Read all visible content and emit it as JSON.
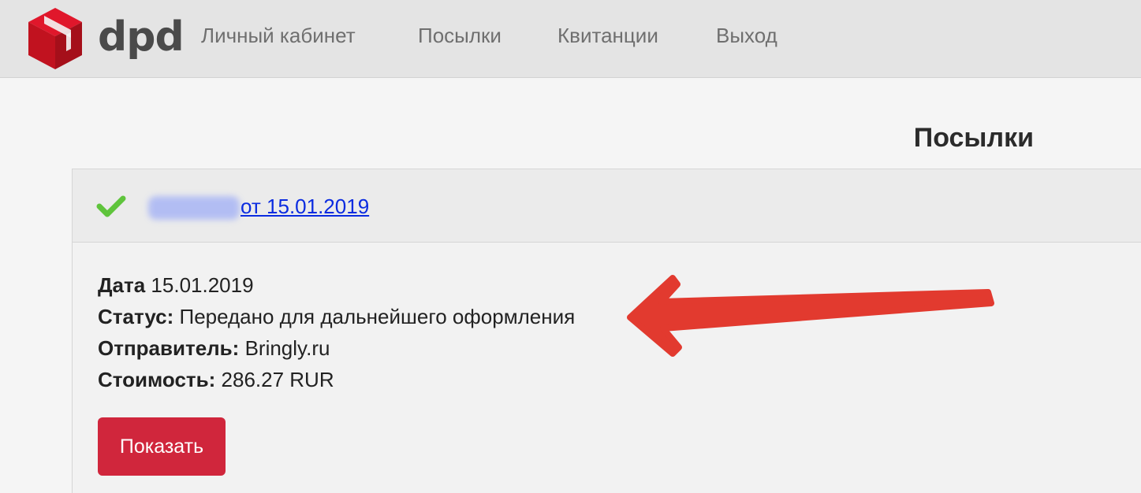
{
  "header": {
    "logo_text": "dpd",
    "nav": [
      {
        "label": "Личный кабинет"
      },
      {
        "label": "Посылки"
      },
      {
        "label": "Квитанции"
      },
      {
        "label": "Выход"
      }
    ]
  },
  "main": {
    "title": "Посылки",
    "parcel": {
      "link_text": "от 15.01.2019",
      "fields": [
        {
          "label": "Дата",
          "value": "15.01.2019"
        },
        {
          "label": "Статус:",
          "value": "Передано для дальнейшего оформления"
        },
        {
          "label": "Отправитель:",
          "value": "Bringly.ru"
        },
        {
          "label": "Стоимость:",
          "value": "286.27 RUR"
        }
      ],
      "show_button_label": "Показать"
    }
  },
  "icons": {
    "logo": "dpd-cube-logo",
    "status": "checkmark-icon",
    "annotation": "red-arrow-annotation"
  },
  "colors": {
    "brand_red": "#d0263c",
    "link_blue": "#0a2be0",
    "check_green": "#5fc43c",
    "arrow_red": "#e23a2f"
  }
}
